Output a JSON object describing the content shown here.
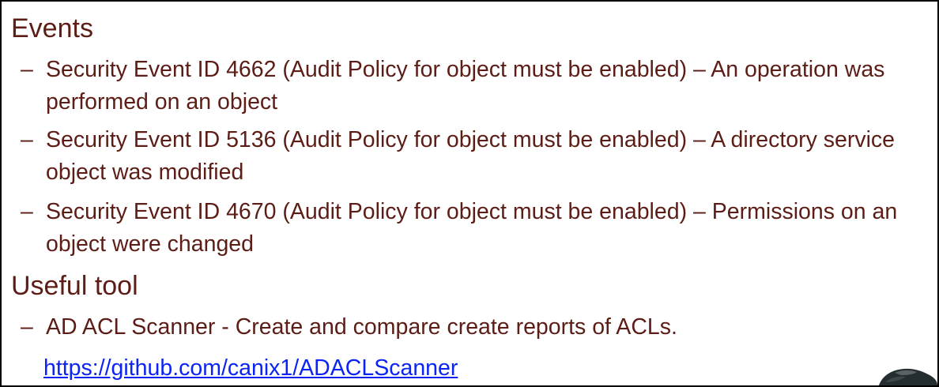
{
  "colors": {
    "text": "#5c1d16",
    "link": "#0b24f3",
    "border": "#000000"
  },
  "events": {
    "heading": "Events",
    "items": [
      {
        "dash": "–",
        "text": "Security Event ID 4662 (Audit Policy for object must be enabled) – An operation was performed on an object"
      },
      {
        "dash": "–",
        "text": "Security Event ID 5136 (Audit Policy for object must be enabled) – A directory service object was modified"
      },
      {
        "dash": "–",
        "text": "Security Event ID 4670 (Audit Policy for object must be enabled) – Permissions on an object were changed"
      }
    ]
  },
  "tools": {
    "heading": "Useful tool",
    "items": [
      {
        "dash": "–",
        "text": "AD ACL Scanner - Create and compare create reports of ACLs."
      }
    ],
    "link": "https://github.com/canix1/ADACLScanner"
  }
}
